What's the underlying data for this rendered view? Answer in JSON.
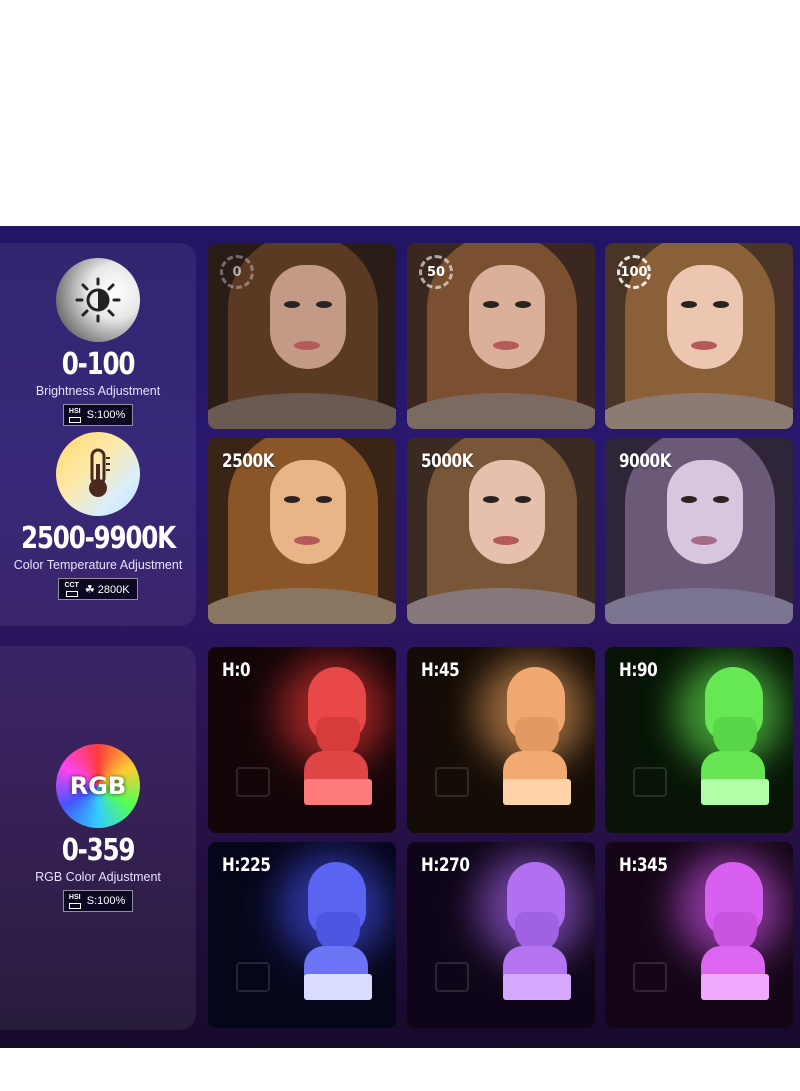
{
  "features": [
    {
      "icon": "brightness-sun-icon",
      "value": "0-100",
      "caption": "Brightness Adjustment",
      "chip_mode": "HSI",
      "chip_value": "S:100%"
    },
    {
      "icon": "thermometer-icon",
      "value": "2500-9900K",
      "caption": "Color Temperature Adjustment",
      "chip_mode": "CCT",
      "chip_value": "☘ 2800K"
    },
    {
      "icon": "rgb-color-wheel-icon",
      "icon_text": "RGB",
      "value": "0-359",
      "caption": "RGB Color Adjustment",
      "chip_mode": "HSI",
      "chip_value": "S:100%"
    }
  ],
  "brightness_tiles": [
    {
      "label": "0"
    },
    {
      "label": "50"
    },
    {
      "label": "100"
    }
  ],
  "temperature_tiles": [
    {
      "label": "2500K",
      "tint": "#f0a460"
    },
    {
      "label": "5000K",
      "tint": "#e8c0a0"
    },
    {
      "label": "9000K",
      "tint": "#b8a8e0"
    }
  ],
  "hue_tiles": [
    {
      "label": "H:0",
      "color": "#ff3b3b"
    },
    {
      "label": "H:45",
      "color": "#ffb066"
    },
    {
      "label": "H:90",
      "color": "#6cff5a"
    },
    {
      "label": "H:225",
      "color": "#4a56ff"
    },
    {
      "label": "H:270",
      "color": "#b56cff"
    },
    {
      "label": "H:345",
      "color": "#e05aff"
    }
  ]
}
